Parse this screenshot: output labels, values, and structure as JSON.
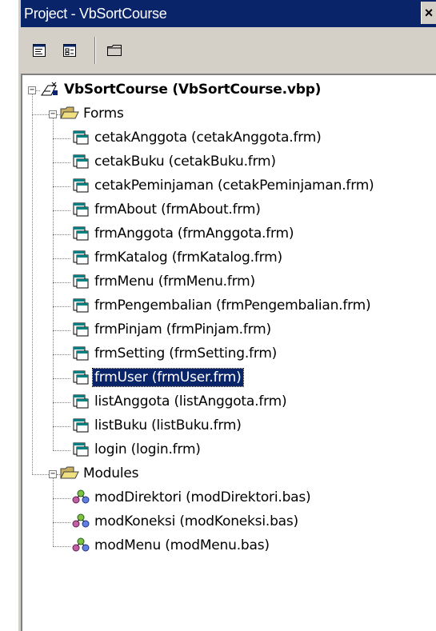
{
  "window": {
    "title": "Project - VbSortCourse",
    "close_glyph": "×"
  },
  "toolbar": {
    "buttons": [
      {
        "name": "view-code-button",
        "icon": "view-code-icon"
      },
      {
        "name": "view-object-button",
        "icon": "view-object-icon"
      },
      {
        "name": "toggle-folders-button",
        "icon": "folder-icon"
      }
    ]
  },
  "tree": {
    "root": {
      "label": "VbSortCourse (VbSortCourse.vbp)",
      "icon": "project-icon",
      "expanded": true
    },
    "folders": [
      {
        "label": "Forms",
        "icon": "folder-open-icon",
        "expanded": true,
        "items": [
          "cetakAnggota (cetakAnggota.frm)",
          "cetakBuku (cetakBuku.frm)",
          "cetakPeminjaman (cetakPeminjaman.frm)",
          "frmAbout (frmAbout.frm)",
          "frmAnggota (frmAnggota.frm)",
          "frmKatalog (frmKatalog.frm)",
          "frmMenu (frmMenu.frm)",
          "frmPengembalian (frmPengembalian.frm)",
          "frmPinjam (frmPinjam.frm)",
          "frmSetting (frmSetting.frm)",
          "frmUser (frmUser.frm)",
          "listAnggota (listAnggota.frm)",
          "listBuku (listBuku.frm)",
          "login (login.frm)"
        ],
        "item_icon": "form-icon"
      },
      {
        "label": "Modules",
        "icon": "folder-open-icon",
        "expanded": true,
        "items": [
          "modDirektori (modDirektori.bas)",
          "modKoneksi (modKoneksi.bas)",
          "modMenu (modMenu.bas)"
        ],
        "item_icon": "module-icon"
      }
    ],
    "selected": "frmUser (frmUser.frm)"
  },
  "colors": {
    "title_bar": "#0a246a",
    "chrome": "#d4d0c8",
    "selection": "#0a246a"
  }
}
